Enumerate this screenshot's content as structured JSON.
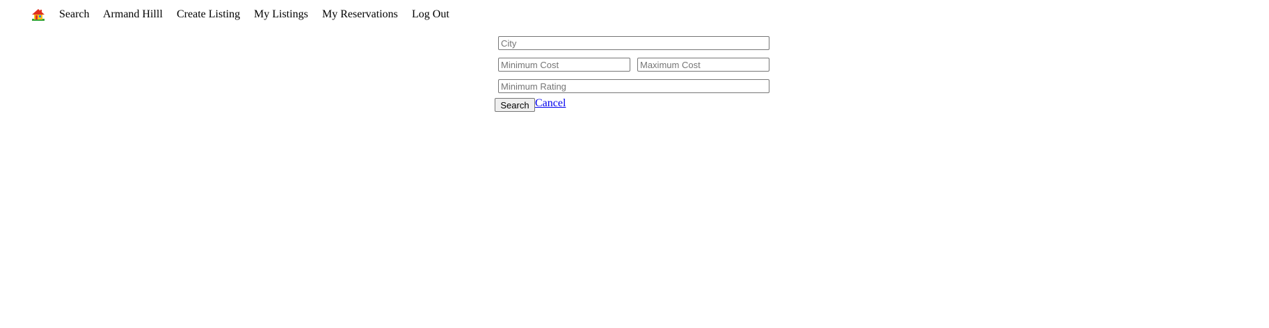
{
  "nav": {
    "home_icon": "house-icon",
    "items": [
      {
        "label": "Search"
      },
      {
        "label": "Armand Hilll"
      },
      {
        "label": "Create Listing"
      },
      {
        "label": "My Listings"
      },
      {
        "label": "My Reservations"
      },
      {
        "label": "Log Out"
      }
    ]
  },
  "search_form": {
    "city": {
      "placeholder": "City",
      "value": ""
    },
    "min_cost": {
      "placeholder": "Minimum Cost",
      "value": ""
    },
    "max_cost": {
      "placeholder": "Maximum Cost",
      "value": ""
    },
    "min_rating": {
      "placeholder": "Minimum Rating",
      "value": ""
    },
    "search_label": "Search",
    "cancel_label": "Cancel"
  },
  "colors": {
    "link": "#0000ee",
    "house_roof": "#e0301e",
    "house_wall": "#f5c518",
    "house_door": "#2a7de1",
    "house_grass": "#3aa63a"
  }
}
